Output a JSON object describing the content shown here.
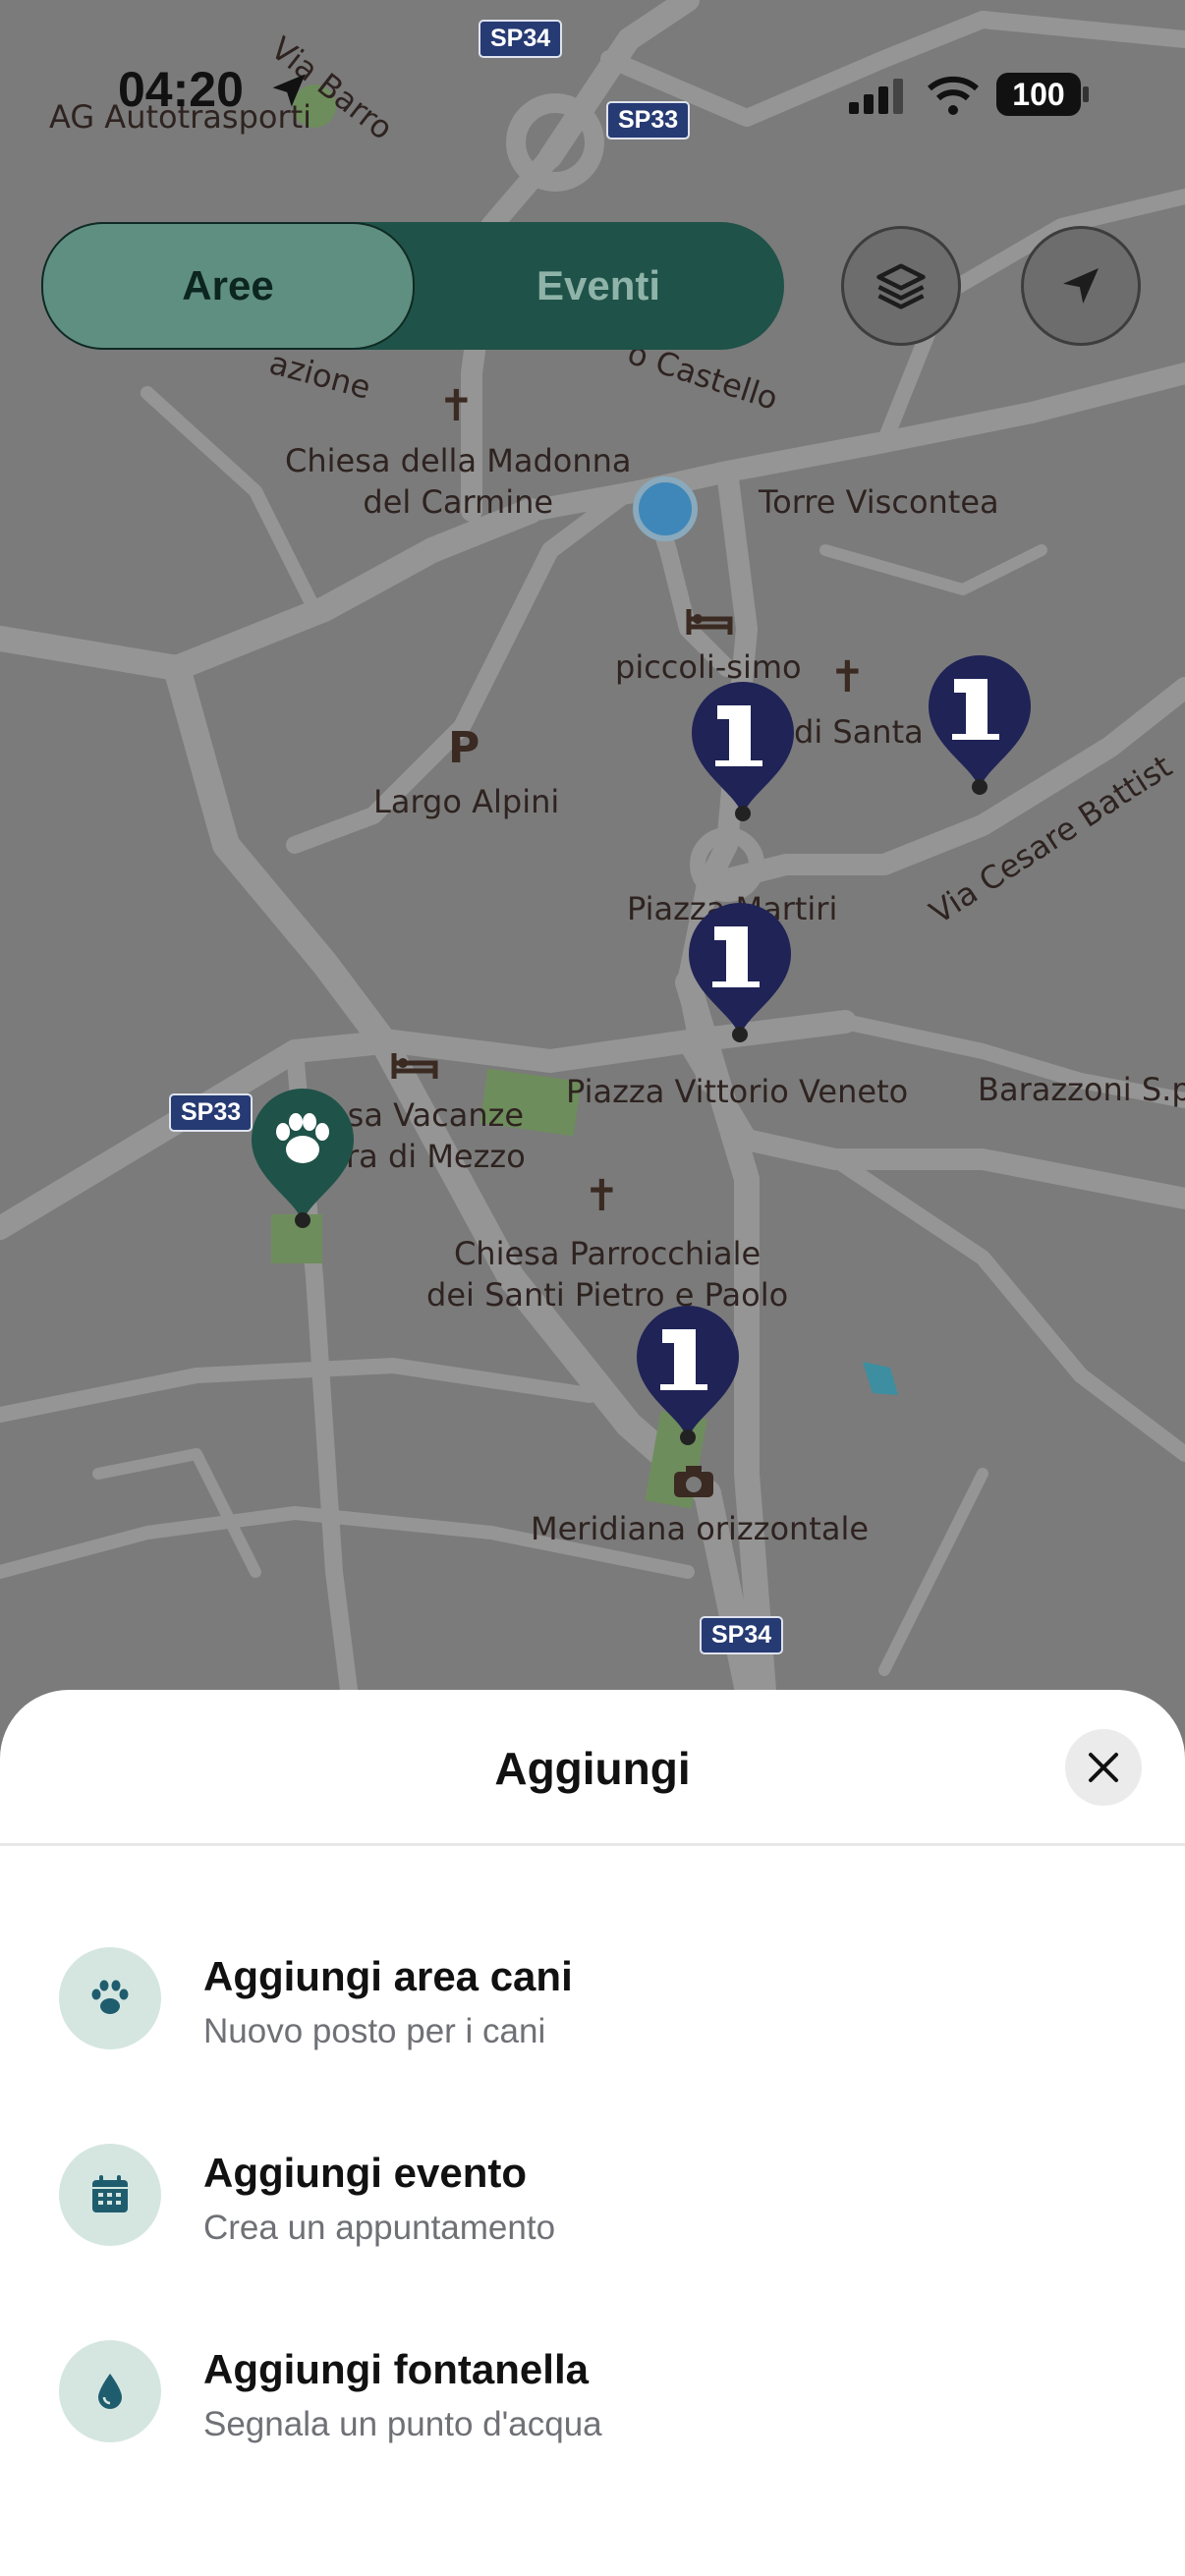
{
  "status_bar": {
    "time": "04:20",
    "battery": "100"
  },
  "map": {
    "roads": [
      "SP34",
      "SP33",
      "SP33",
      "SP34"
    ],
    "labels": {
      "via_barro": "Via Barro",
      "ag": "AG Autotrasporti",
      "azione": "azione",
      "castello": "o Castello",
      "madonna": "Chiesa della Madonna\ndel Carmine",
      "torre": "Torre Viscontea",
      "piccoli": "piccoli-simo",
      "santa": "di Santa",
      "largo": "Largo Alpini",
      "martiri": "Piazza Martiri",
      "cesare": "Via Cesare Battist",
      "vacanze": "sa Vacanze\nra di Mezzo",
      "vittorio": "Piazza Vittorio Veneto",
      "barazzoni": "Barazzoni S.p",
      "parrocchiale": "Chiesa Parrocchiale\ndei Santi Pietro e Paolo",
      "meridiana": "Meridiana orizzontale"
    }
  },
  "segmented": {
    "aree": "Aree",
    "eventi": "Eventi"
  },
  "icons": {
    "layers": "layers-icon",
    "locate": "location-arrow-icon",
    "close": "close-icon",
    "paw": "paw-icon",
    "calendar": "calendar-icon",
    "drop": "water-drop-icon",
    "fountain": "fountain-marker-icon"
  },
  "colors": {
    "accent_dark": "#1f5248",
    "accent_light": "#5f8f80",
    "marker_navy": "#1f2356",
    "icon_bg": "#d5e6e1"
  },
  "sheet": {
    "title": "Aggiungi",
    "options": [
      {
        "title": "Aggiungi area cani",
        "subtitle": "Nuovo posto per i cani"
      },
      {
        "title": "Aggiungi evento",
        "subtitle": "Crea un appuntamento"
      },
      {
        "title": "Aggiungi fontanella",
        "subtitle": "Segnala un punto d'acqua"
      }
    ]
  }
}
